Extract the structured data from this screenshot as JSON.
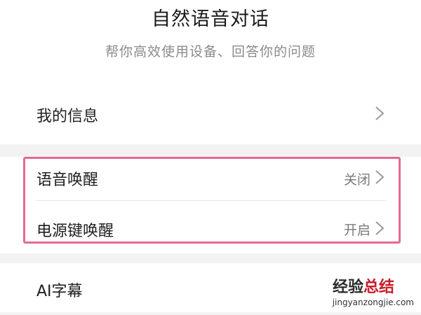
{
  "header": {
    "title": "自然语音对话",
    "subtitle": "帮你高效使用设备、回答你的问题"
  },
  "settings": {
    "my_info": {
      "label": "我的信息"
    },
    "voice_wake": {
      "label": "语音唤醒",
      "value": "关闭"
    },
    "power_key_wake": {
      "label": "电源键唤醒",
      "value": "开启"
    },
    "ai_caption": {
      "label": "AI字幕"
    }
  },
  "watermark": {
    "main_prefix": "经验",
    "main_accent": "总结",
    "url": "jingyanzongjie.com"
  },
  "colors": {
    "highlight_border": "#e36a96",
    "section_gap": "#f2f2f2",
    "watermark_accent": "#c71c2a"
  },
  "icons": {
    "row_arrow": "chevron-right-icon"
  }
}
